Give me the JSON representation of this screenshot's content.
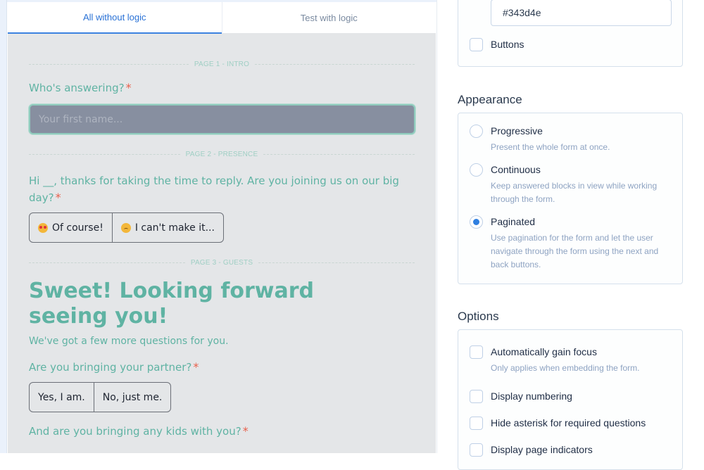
{
  "preview": {
    "tabs": [
      {
        "label": "All without logic",
        "active": true
      },
      {
        "label": "Test with logic",
        "active": false
      }
    ],
    "pages": [
      {
        "label": "PAGE 1 - INTRO"
      },
      {
        "label": "PAGE 2 - PRESENCE"
      },
      {
        "label": "PAGE 3 - GUESTS"
      }
    ],
    "q1": {
      "text": "Who's answering?",
      "required_mark": "*",
      "placeholder": "Your first name..."
    },
    "q2": {
      "text": "Hi __, thanks for taking the time to reply. Are you joining us on our big day?",
      "required_mark": "*",
      "options": [
        {
          "icon": "heart-eyes-emoji-icon",
          "label": "Of course!"
        },
        {
          "icon": "disappointed-emoji-icon",
          "label": "I can't make it..."
        }
      ]
    },
    "heading": "Sweet! Looking forward seeing you!",
    "subtext": "We've got a few more questions for you.",
    "q3": {
      "text": "Are you bringing your partner?",
      "required_mark": "*",
      "options": [
        {
          "label": "Yes, I am."
        },
        {
          "label": "No, just me."
        }
      ]
    },
    "q4": {
      "text": "And are you bringing any kids with you?",
      "required_mark": "*"
    }
  },
  "settings": {
    "color_value": "#343d4e",
    "buttons_label": "Buttons",
    "buttons_checked": false,
    "appearance": {
      "title": "Appearance",
      "options": [
        {
          "label": "Progressive",
          "desc": "Present the whole form at once.",
          "checked": false
        },
        {
          "label": "Continuous",
          "desc": "Keep answered blocks in view while working through the form.",
          "checked": false
        },
        {
          "label": "Paginated",
          "desc": "Use pagination for the form and let the user navigate through the form using the next and back buttons.",
          "checked": true
        }
      ]
    },
    "options": {
      "title": "Options",
      "items": [
        {
          "label": "Automatically gain focus",
          "desc": "Only applies when embedding the form.",
          "checked": false
        },
        {
          "label": "Display numbering",
          "checked": false
        },
        {
          "label": "Hide asterisk for required questions",
          "checked": false
        },
        {
          "label": "Display page indicators",
          "checked": false
        }
      ]
    }
  },
  "colors": {
    "accent": "#3b82e0",
    "form_text": "#5fb3a3",
    "required": "#e8604c",
    "preview_bg": "#e4e6e8"
  }
}
